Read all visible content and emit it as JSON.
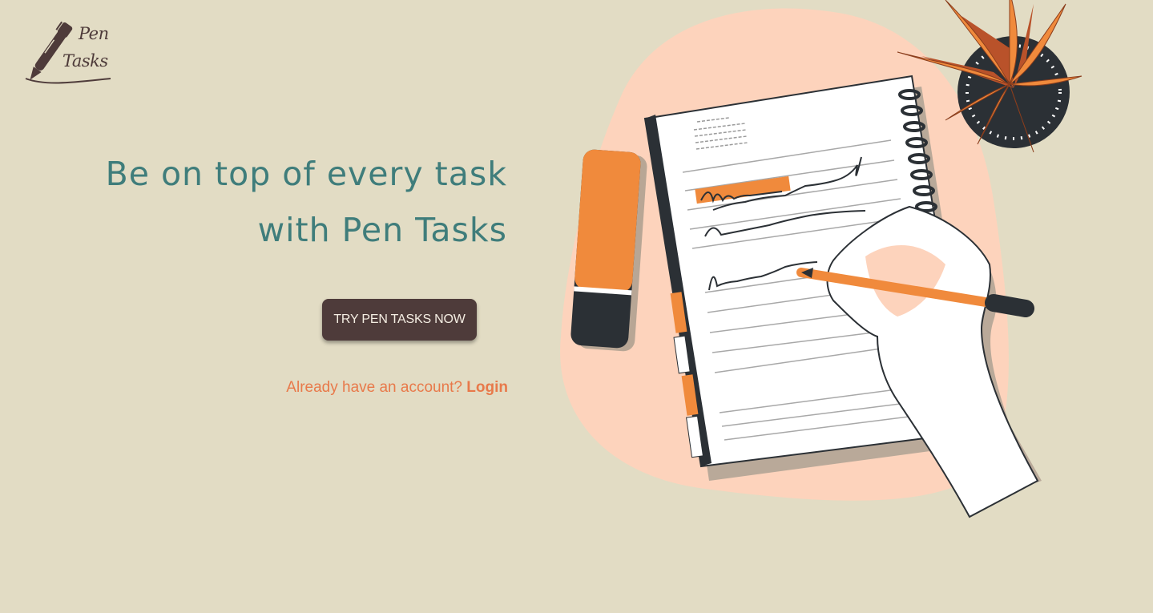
{
  "brand": {
    "logo_line1": "Pen",
    "logo_line2": "Tasks",
    "logo_icon": "fountain-pen-icon"
  },
  "hero": {
    "headline_line1": "Be on top of every task",
    "headline_line2": "with Pen Tasks",
    "cta_label": "TRY PEN TASKS NOW",
    "login_prompt": "Already have an account?",
    "login_link": "Login"
  },
  "illustration": {
    "subject": "hand-writing-in-notebook-illustration"
  },
  "colors": {
    "background": "#e2dcc4",
    "headline": "#3f7d7b",
    "button": "#4e3b3a",
    "accent": "#e8794a",
    "blob": "#fdd3bc"
  }
}
